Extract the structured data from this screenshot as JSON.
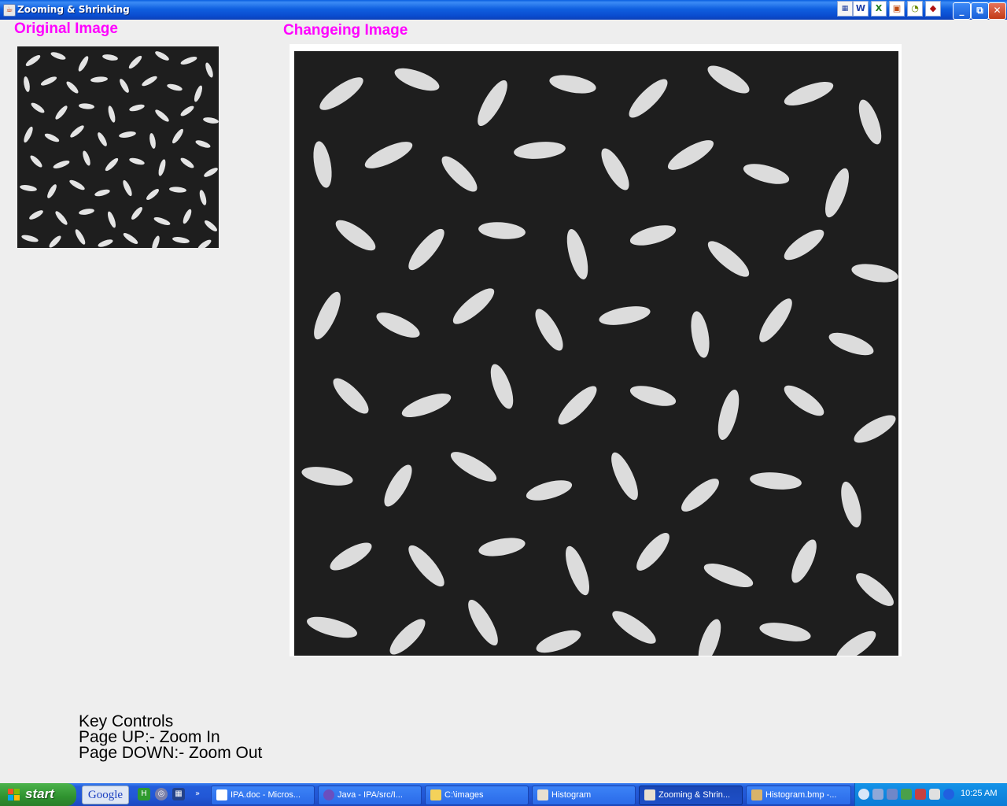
{
  "window": {
    "title": "Zooming & Shrinking",
    "app_icon": "java-cup-icon"
  },
  "quick_launch_top": [
    "app-icon-1",
    "word-icon",
    "excel-icon",
    "powerpoint-icon",
    "clock-icon",
    "acrobat-icon"
  ],
  "main": {
    "original_heading": "Original Image",
    "changing_heading": "Changeing Image",
    "original_image_desc": "rice grains on dark background",
    "key_controls": {
      "title": "Key Controls",
      "line1": "Page UP:- Zoom In",
      "line2": "Page DOWN:- Zoom Out"
    }
  },
  "taskbar": {
    "start_label": "start",
    "google_label": "Google",
    "tasks": [
      {
        "label": "IPA.doc - Micros...",
        "icon": "word-icon"
      },
      {
        "label": "Java - IPA/src/I...",
        "icon": "eclipse-icon"
      },
      {
        "label": "C:\\images",
        "icon": "folder-icon"
      },
      {
        "label": "Histogram",
        "icon": "java-cup-icon"
      },
      {
        "label": "Zooming & Shrin...",
        "icon": "java-cup-icon"
      },
      {
        "label": "Histogram.bmp -...",
        "icon": "paint-icon"
      }
    ],
    "clock": "10:25 AM"
  },
  "colors": {
    "heading": "#ff00ff",
    "titlebar": "#0a4cd0",
    "taskbar": "#245edb"
  }
}
